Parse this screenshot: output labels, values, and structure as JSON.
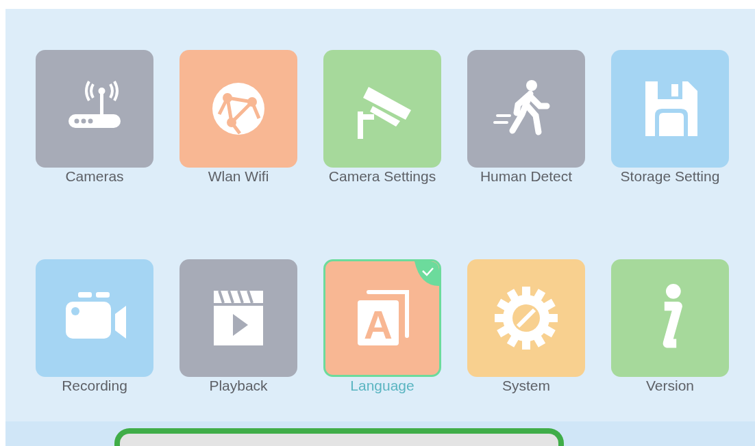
{
  "menu": {
    "tiles": [
      {
        "label": "Cameras",
        "kind": "router",
        "color": "#a7abb7",
        "selected": false
      },
      {
        "label": "Wlan Wifi",
        "kind": "globe",
        "color": "#f8b793",
        "selected": false
      },
      {
        "label": "Camera Settings",
        "kind": "cctv",
        "color": "#a6d99b",
        "selected": false
      },
      {
        "label": "Human Detect",
        "kind": "walker",
        "color": "#a7abb7",
        "selected": false
      },
      {
        "label": "Storage Setting",
        "kind": "floppy",
        "color": "#a5d5f3",
        "selected": false
      },
      {
        "label": "Recording",
        "kind": "video",
        "color": "#a5d5f3",
        "selected": false
      },
      {
        "label": "Playback",
        "kind": "clapper",
        "color": "#a7abb7",
        "selected": false
      },
      {
        "label": "Language",
        "kind": "letter",
        "icon_text": "A",
        "color": "#f8b793",
        "selected": true
      },
      {
        "label": "System",
        "kind": "gear",
        "color": "#f8d08f",
        "selected": false
      },
      {
        "label": "Version",
        "kind": "info",
        "color": "#a6d99b",
        "selected": false
      }
    ]
  }
}
